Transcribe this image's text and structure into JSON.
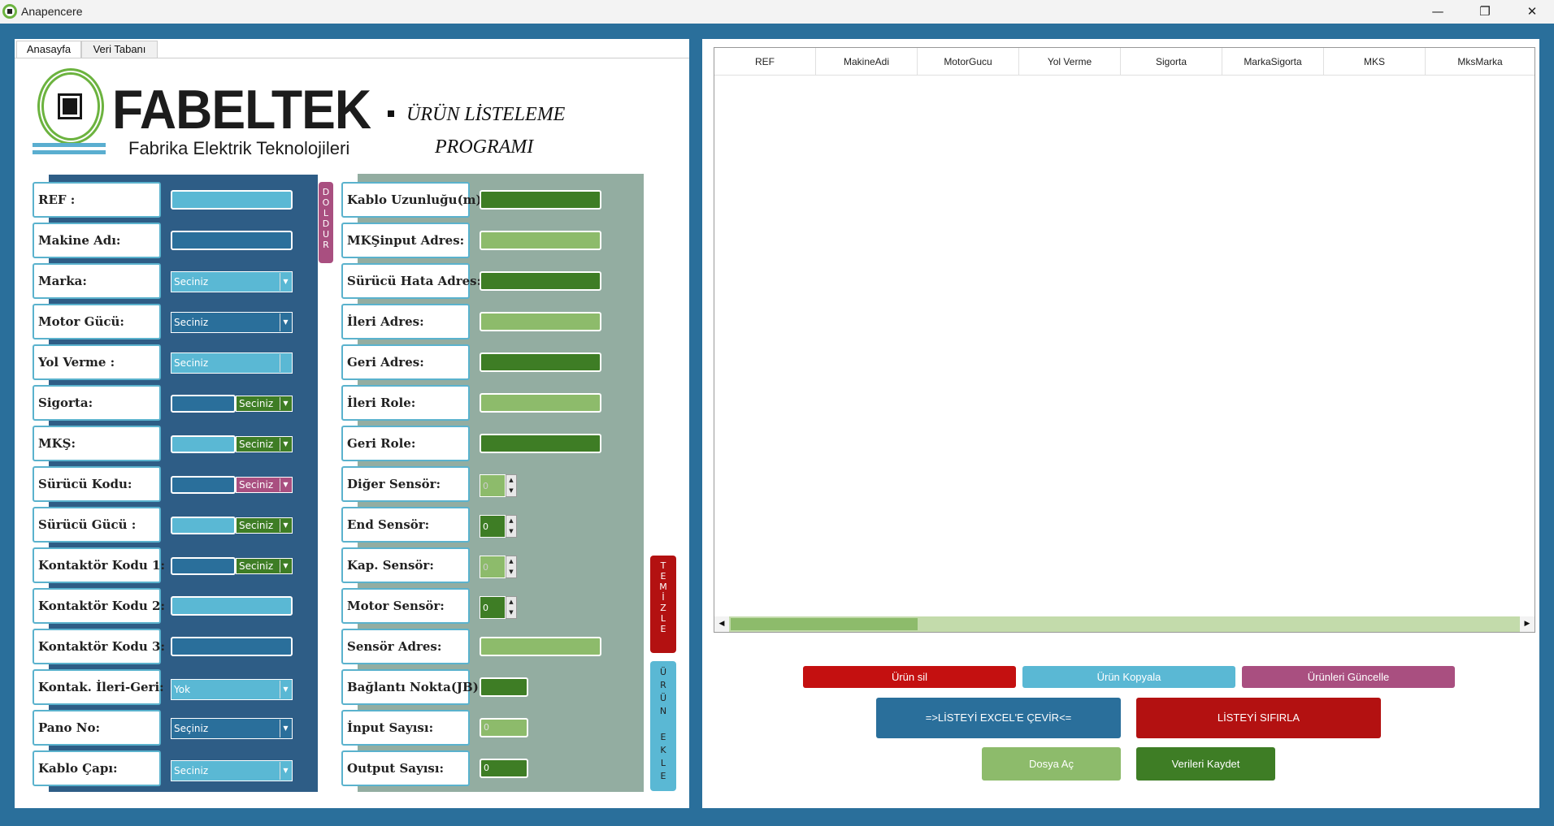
{
  "window": {
    "title": "Anapencere",
    "minimize": "—",
    "restore": "❐",
    "close": "✕"
  },
  "tabs": [
    {
      "label": "Anasayfa",
      "active": true
    },
    {
      "label": "Veri Tabanı",
      "active": false
    }
  ],
  "logo": {
    "brand": "FABELTEK",
    "subtitle": "Fabrika Elektrik Teknolojileri"
  },
  "program": {
    "line1": "ÜRÜN LİSTELEME",
    "line2": "PROGRAMI"
  },
  "left_form": {
    "ref": "REF :",
    "makine_adi": "Makine Adı:",
    "marka": {
      "label": "Marka:",
      "value": "Seciniz"
    },
    "motor_gucu": {
      "label": "Motor Gücü:",
      "value": "Seciniz"
    },
    "yol_verme": {
      "label": "Yol Verme :",
      "value": "Seciniz"
    },
    "sigorta": {
      "label": "Sigorta:",
      "value": "Seciniz"
    },
    "mks": {
      "label": "MKŞ:",
      "value": "Seciniz"
    },
    "surucu_kodu": {
      "label": "Sürücü Kodu:",
      "value": "Seciniz"
    },
    "surucu_gucu": {
      "label": "Sürücü Gücü :",
      "value": "Seciniz"
    },
    "kontaktor1": {
      "label": "Kontaktör Kodu 1:",
      "value": "Seciniz"
    },
    "kontaktor2": "Kontaktör Kodu 2:",
    "kontaktor3": "Kontaktör Kodu 3:",
    "kontak_ileri_geri": {
      "label": "Kontak. İleri-Geri:",
      "value": "Yok"
    },
    "pano_no": {
      "label": "Pano No:",
      "value": "Seçiniz"
    },
    "kablo_capi": {
      "label": "Kablo Çapı:",
      "value": "Seciniz"
    }
  },
  "right_form": {
    "kablo_uzunlugu": "Kablo Uzunluğu(m):",
    "mks_input": "MKŞinput Adres:",
    "surucu_hata": "Sürücü Hata Adres:",
    "ileri_adres": "İleri Adres:",
    "geri_adres": "Geri Adres:",
    "ileri_role": "İleri Role:",
    "geri_role": "Geri Role:",
    "diger_sensor": {
      "label": "Diğer Sensör:",
      "value": "0"
    },
    "end_sensor": {
      "label": "End Sensör:",
      "value": "0"
    },
    "kap_sensor": {
      "label": "Kap. Sensör:",
      "value": "0"
    },
    "motor_sensor": {
      "label": "Motor Sensör:",
      "value": "0"
    },
    "sensor_adres": "Sensör Adres:",
    "baglanti_nokta": "Bağlantı Nokta(JB):",
    "input_sayisi": {
      "label": "İnput Sayısı:",
      "value": "0"
    },
    "output_sayisi": {
      "label": "Output Sayısı:",
      "value": "0"
    }
  },
  "side_buttons": {
    "doldur": [
      "D",
      "O",
      "L",
      "D",
      "U",
      "R"
    ],
    "temizle": [
      "T",
      "E",
      "M",
      "İ",
      "Z",
      "L",
      "E"
    ],
    "urun_ekle": [
      "Ü",
      "R",
      "Ü",
      "N",
      "",
      "E",
      "K",
      "L",
      "E"
    ]
  },
  "grid": {
    "columns": [
      "REF",
      "MakineAdi",
      "MotorGucu",
      "Yol Verme",
      "Sigorta",
      "MarkaSigorta",
      "MKS",
      "MksMarka"
    ]
  },
  "actions": {
    "urun_sil": "Ürün sil",
    "urun_kopyala": "Ürün Kopyala",
    "urunleri_guncelle": "Ürünleri Güncelle",
    "excel": "=>LİSTEYİ EXCEL'E ÇEVİR<=",
    "sifirla": "LİSTEYİ SIFIRLA",
    "dosya_ac": "Dosya Aç",
    "kaydet": "Verileri Kaydet"
  },
  "colors": {
    "bg": "#2a6f9b",
    "blue_light": "#5ab8d4",
    "green_dark": "#3e7d25",
    "green_light": "#8dbb6b",
    "red": "#c41010",
    "pink": "#a94f80"
  }
}
